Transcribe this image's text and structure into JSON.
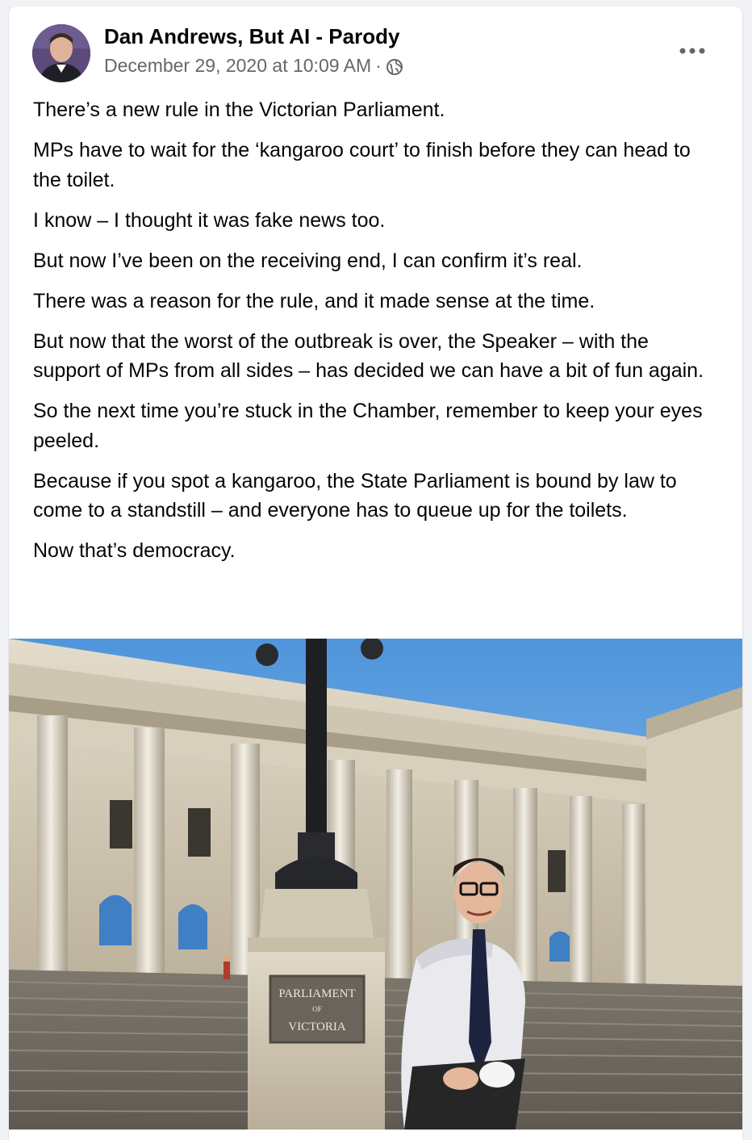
{
  "post": {
    "author": "Dan Andrews, But AI - Parody",
    "timestamp": "December 29, 2020 at 10:09 AM",
    "separator": "·",
    "privacy_icon": "globe-icon",
    "more_icon": "more-horizontal-icon",
    "paragraphs": [
      "There’s a new rule in the Victorian Parliament.",
      "MPs have to wait for the ‘kangaroo court’ to finish before they can head to the toilet.",
      "I know – I thought it was fake news too.",
      "But now I’ve been on the receiving end, I can confirm it’s real.",
      "There was a reason for the rule, and it made sense at the time.",
      "But now that the worst of the outbreak is over, the Speaker – with the support of MPs from all sides – has decided we can have a bit of fun again.",
      "So the next time you’re stuck in the Chamber, remember to keep your eyes peeled.",
      "Because if you spot a kangaroo, the State Parliament is bound by law to come to a standstill – and everyone has to queue up for the toilets.",
      "Now that’s democracy."
    ]
  },
  "image": {
    "sign_line1": "PARLIAMENT",
    "sign_line2": "OF",
    "sign_line3": "VICTORIA"
  },
  "colors": {
    "primary_text": "#050505",
    "secondary_text": "#65676b",
    "sky": "#7fb3e0",
    "stone": "#d9d2c2"
  }
}
